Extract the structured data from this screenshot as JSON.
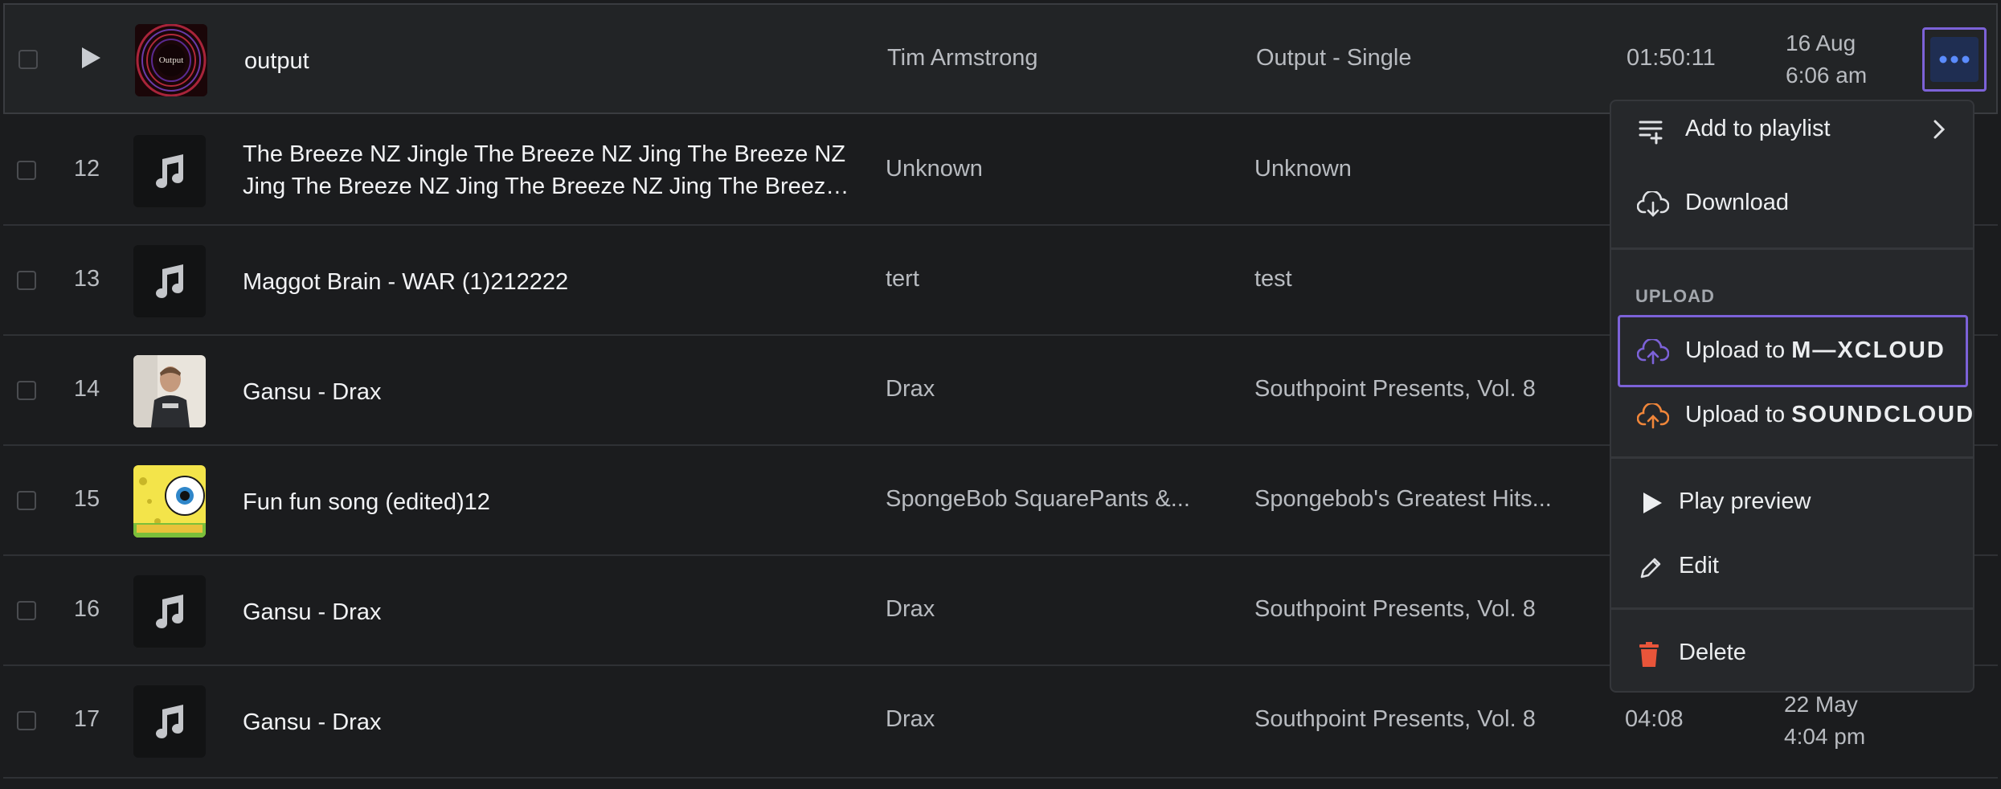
{
  "tracks": [
    {
      "num": "",
      "title_1": "output",
      "title_2": "",
      "artist": "Tim Armstrong",
      "album": "Output - Single",
      "duration": "01:50:11",
      "date_1": "16 Aug",
      "date_2": "6:06 am",
      "thumb": "output-cover-art"
    },
    {
      "num": "12",
      "title_1": "The Breeze NZ Jingle The Breeze NZ Jing The Breeze NZ",
      "title_2": "Jing The Breeze NZ Jing The Breeze NZ Jing The Breeze...",
      "artist": "Unknown",
      "album": "Unknown",
      "duration": "",
      "date_1": "",
      "date_2": "",
      "thumb": "music-note-icon"
    },
    {
      "num": "13",
      "title_1": "Maggot Brain - WAR (1)212222",
      "title_2": "",
      "artist": "tert",
      "album": "test",
      "duration": "",
      "date_1": "",
      "date_2": "",
      "thumb": "music-note-icon"
    },
    {
      "num": "14",
      "title_1": "Gansu - Drax",
      "title_2": "",
      "artist": "Drax",
      "album": "Southpoint Presents, Vol. 8",
      "duration": "",
      "date_1": "",
      "date_2": "",
      "thumb": "person-photo"
    },
    {
      "num": "15",
      "title_1": "Fun fun song (edited)12",
      "title_2": "",
      "artist": "SpongeBob SquarePants &...",
      "album": "Spongebob's Greatest Hits...",
      "duration": "",
      "date_1": "",
      "date_2": "",
      "thumb": "spongebob-cover-art"
    },
    {
      "num": "16",
      "title_1": "Gansu - Drax",
      "title_2": "",
      "artist": "Drax",
      "album": "Southpoint Presents, Vol. 8",
      "duration": "",
      "date_1": "",
      "date_2": "",
      "thumb": "music-note-icon"
    },
    {
      "num": "17",
      "title_1": "Gansu - Drax",
      "title_2": "",
      "artist": "Drax",
      "album": "Southpoint Presents, Vol. 8",
      "duration": "04:08",
      "date_1": "22 May",
      "date_2": "4:04 pm",
      "thumb": "music-note-icon"
    }
  ],
  "thumb_text": {
    "output_cover": "Output"
  },
  "menu": {
    "add_to_playlist": "Add to playlist",
    "download": "Download",
    "upload_section": "UPLOAD",
    "upload_to": "Upload to",
    "mixcloud": "M—XCLOUD",
    "soundcloud": "SOUNDCLOUD",
    "play_preview": "Play preview",
    "edit": "Edit",
    "delete": "Delete"
  },
  "colors": {
    "accent": "#7c62d8",
    "more_button_bg": "#1f2e52",
    "more_dots": "#5b8cff",
    "soundcloud": "#f0863a",
    "delete": "#e8553a"
  }
}
